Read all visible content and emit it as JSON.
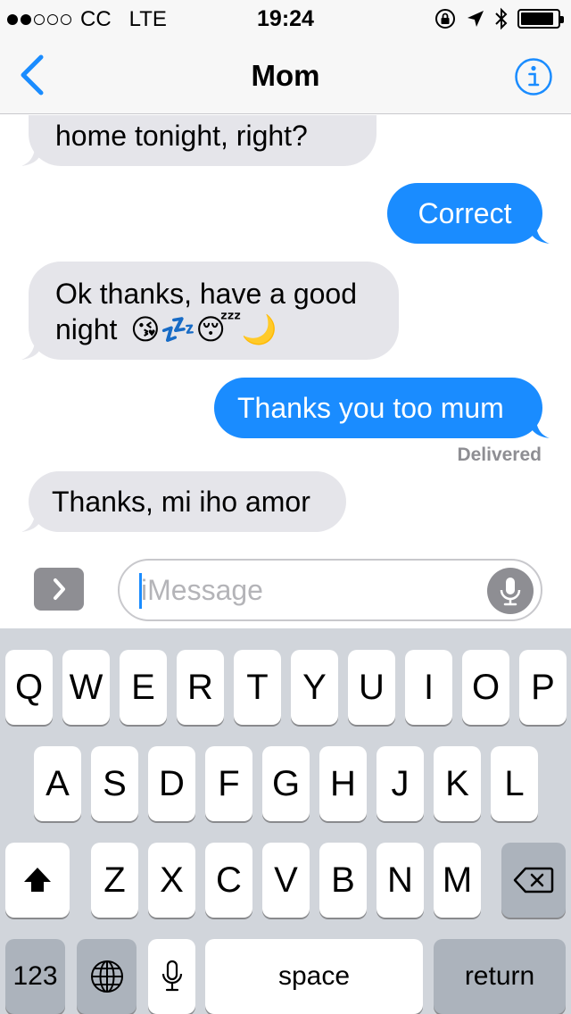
{
  "status_bar": {
    "carrier": "CC",
    "network": "LTE",
    "time": "19:24",
    "signal_filled": 2,
    "signal_total": 5,
    "battery_level": 0.9
  },
  "nav": {
    "title": "Mom",
    "back_icon": "chevron-left-icon",
    "info_icon": "info-icon",
    "accent_color": "#1a8cff"
  },
  "messages": [
    {
      "from": "them",
      "text": "home tonight, right?"
    },
    {
      "from": "me",
      "text": "Correct"
    },
    {
      "from": "them",
      "line1": "Ok thanks, have a good",
      "line2": "night",
      "emoji": "😘💤😴🌙"
    },
    {
      "from": "me",
      "text": "Thanks you too mum"
    },
    {
      "from": "them",
      "text": "Thanks, mi iho amor"
    }
  ],
  "delivery_status": "Delivered",
  "composer": {
    "placeholder": "iMessage",
    "expand_icon": "chevron-right-icon",
    "mic_icon": "microphone-icon"
  },
  "keyboard": {
    "row1": [
      "Q",
      "W",
      "E",
      "R",
      "T",
      "Y",
      "U",
      "I",
      "O",
      "P"
    ],
    "row2": [
      "A",
      "S",
      "D",
      "F",
      "G",
      "H",
      "J",
      "K",
      "L"
    ],
    "row3": [
      "Z",
      "X",
      "C",
      "V",
      "B",
      "N",
      "M"
    ],
    "numbers_label": "123",
    "space_label": "space",
    "return_label": "return",
    "shift_icon": "shift-icon",
    "delete_icon": "delete-icon",
    "globe_icon": "globe-icon",
    "dictation_icon": "microphone-icon"
  },
  "colors": {
    "incoming_bubble": "#e5e5ea",
    "outgoing_bubble": "#1a8cff",
    "keyboard_background": "#d1d5db"
  }
}
